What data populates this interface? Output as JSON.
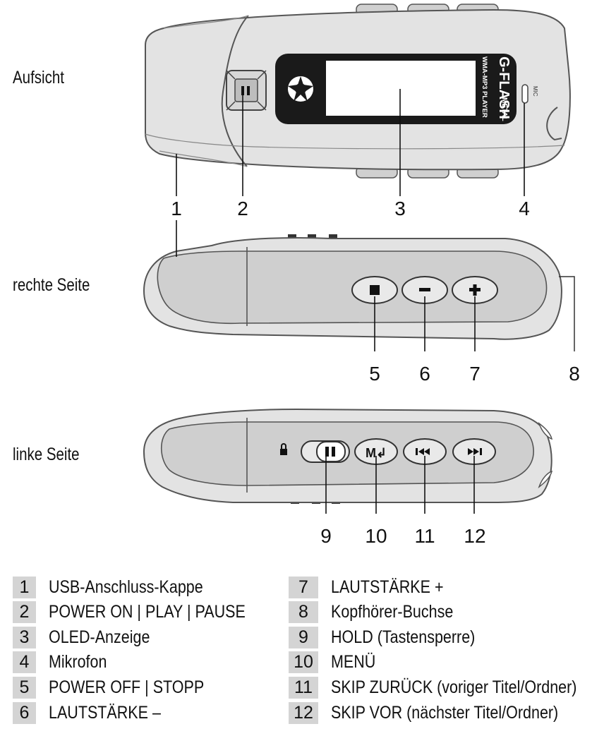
{
  "views": {
    "top": "Aufsicht",
    "right": "rechte Seite",
    "left": "linke Seite"
  },
  "device": {
    "brand": "G-FLASH",
    "subtitle": "WMA-MP3 PLAYER",
    "edition": "METAL",
    "mic_label": "MIC"
  },
  "callouts": [
    "1",
    "2",
    "3",
    "4",
    "5",
    "6",
    "7",
    "8",
    "9",
    "10",
    "11",
    "12"
  ],
  "legend": [
    {
      "num": "1",
      "text": "USB-Anschluss-Kappe"
    },
    {
      "num": "2",
      "text": "POWER ON | PLAY | PAUSE"
    },
    {
      "num": "3",
      "text": "OLED-Anzeige"
    },
    {
      "num": "4",
      "text": "Mikrofon"
    },
    {
      "num": "5",
      "text": "POWER OFF | STOPP"
    },
    {
      "num": "6",
      "text": "LAUTSTÄRKE –"
    },
    {
      "num": "7",
      "text": "LAUTSTÄRKE +"
    },
    {
      "num": "8",
      "text": "Kopfhörer-Buchse"
    },
    {
      "num": "9",
      "text": "HOLD (Tastensperre)"
    },
    {
      "num": "10",
      "text": "MENÜ"
    },
    {
      "num": "11",
      "text": "SKIP ZURÜCK (voriger Titel/Ordner)"
    },
    {
      "num": "12",
      "text": "SKIP VOR (nächster Titel/Ordner)"
    }
  ],
  "colors": {
    "body": "#e3e3e3",
    "panel": "#cfcfcf",
    "outline": "#555555",
    "display_bezel": "#1a1a1a",
    "legend_box": "#d4d4d4"
  },
  "icons": [
    "pause-icon",
    "stop-icon",
    "minus-icon",
    "plus-icon",
    "lock-icon",
    "menu-icon",
    "skip-back-icon",
    "skip-forward-icon"
  ]
}
